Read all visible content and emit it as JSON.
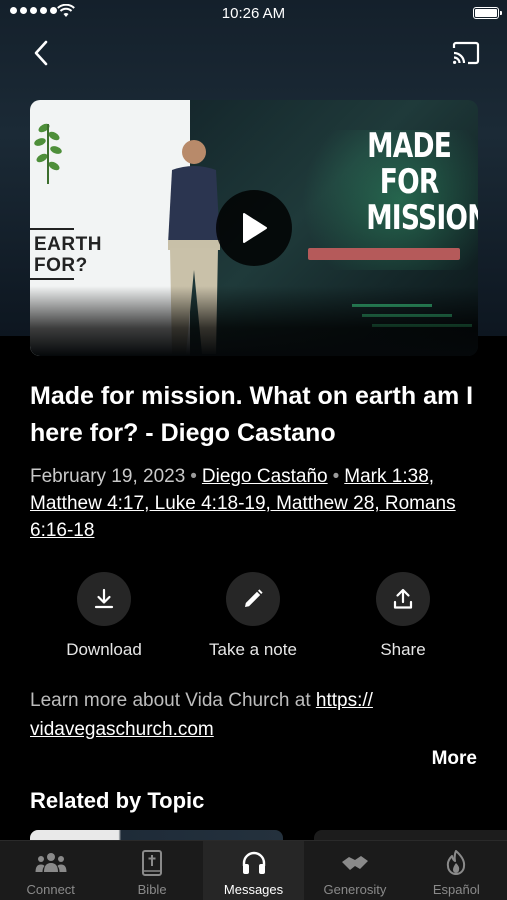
{
  "status_bar": {
    "time": "10:26 AM"
  },
  "video": {
    "title_graphic_line1": "MADE FOR",
    "title_graphic_line2": "MISSION",
    "screen_text_line1": "EARTH",
    "screen_text_line2": "FOR?"
  },
  "sermon": {
    "title": "Made for mission. What on earth am I here for? -  Diego Castano",
    "date": "February 19, 2023",
    "speaker": "Diego Castaño",
    "scripture": "Mark 1:38, Matthew 4:17, Luke 4:18-19, Matthew 28, Romans 6:16-18"
  },
  "actions": [
    {
      "label": "Download",
      "icon": "download-icon"
    },
    {
      "label": "Take a note",
      "icon": "pencil-icon"
    },
    {
      "label": "Share",
      "icon": "share-icon"
    }
  ],
  "description": {
    "text": "Learn more about Vida Church at ",
    "link_a": "https://",
    "link_b": "vidavegaschurch.com"
  },
  "more_label": "More",
  "related_heading": "Related by Topic",
  "tabs": [
    {
      "label": "Connect",
      "icon": "people-icon",
      "active": false
    },
    {
      "label": "Bible",
      "icon": "bible-icon",
      "active": false
    },
    {
      "label": "Messages",
      "icon": "headphones-icon",
      "active": true
    },
    {
      "label": "Generosity",
      "icon": "handshake-icon",
      "active": false
    },
    {
      "label": "Español",
      "icon": "flame-icon",
      "active": false
    }
  ],
  "colors": {
    "background": "#000000",
    "tab_bar": "#1b1b1b",
    "action_circle": "#262626",
    "muted_text": "#c9c9c9"
  }
}
